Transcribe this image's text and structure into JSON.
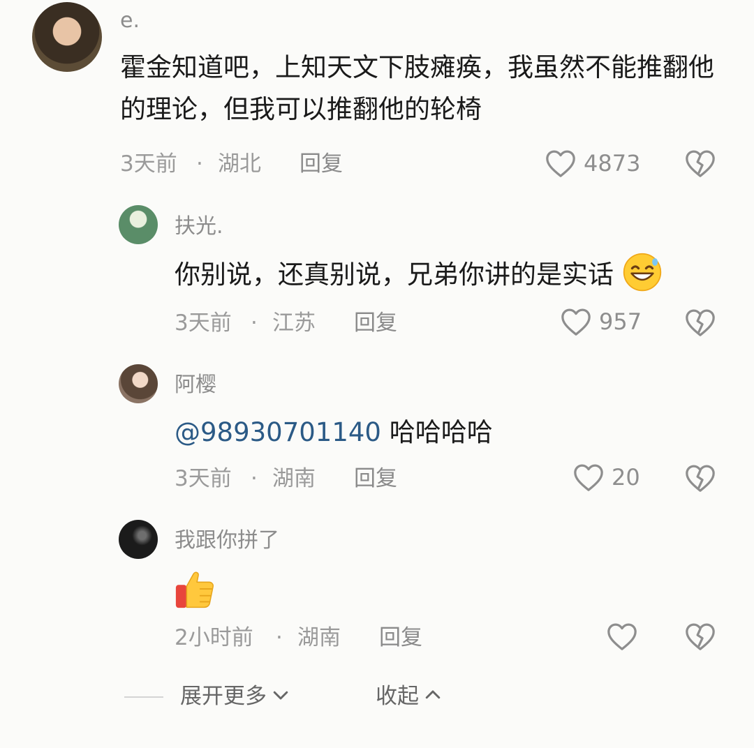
{
  "comments": [
    {
      "username": "e.",
      "text": "霍金知道吧，上知天文下肢瘫痪，我虽然不能推翻他的理论，但我可以推翻他的轮椅",
      "time": "3天前",
      "separator": "·",
      "location": "湖北",
      "reply_label": "回复",
      "likes": "4873"
    },
    {
      "username": "扶光.",
      "text": "你别说，还真别说，兄弟你讲的是实话",
      "emoji": "grinning-sweat-emoji",
      "time": "3天前",
      "separator": "·",
      "location": "江苏",
      "reply_label": "回复",
      "likes": "957"
    },
    {
      "username": "阿樱",
      "mention": "@98930701140",
      "text": " 哈哈哈哈",
      "time": "3天前",
      "separator": "·",
      "location": "湖南",
      "reply_label": "回复",
      "likes": "20"
    },
    {
      "username": "我跟你拼了",
      "emoji": "thumbs-up-emoji",
      "time": "2小时前",
      "separator": "·",
      "location": "湖南",
      "reply_label": "回复",
      "likes": ""
    }
  ],
  "footer": {
    "expand_label": "展开更多",
    "collapse_label": "收起"
  },
  "colors": {
    "mention": "#2b5a86",
    "muted_text": "#9a9a9a",
    "body_text": "#1a1a1a",
    "background": "#fbfbf9"
  }
}
